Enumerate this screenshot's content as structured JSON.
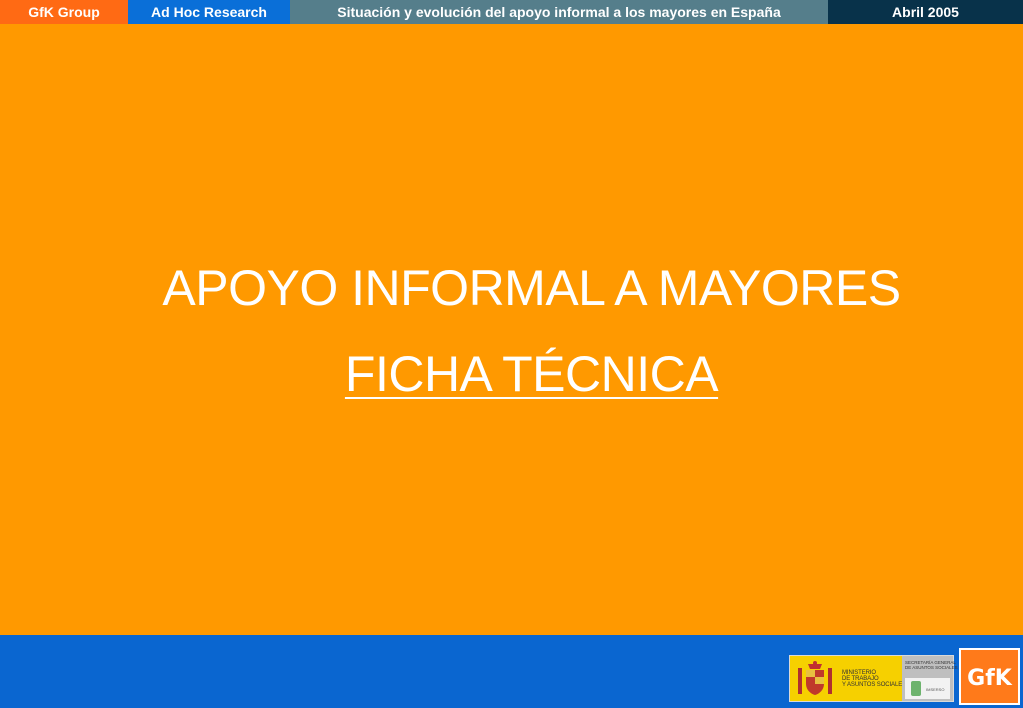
{
  "header": {
    "group": "GfK Group",
    "division": "Ad Hoc Research",
    "study_title": "Situación y evolución del apoyo informal a los mayores en España",
    "date": "Abril 2005"
  },
  "slide": {
    "title_line1": "APOYO INFORMAL A MAYORES",
    "title_line2": "FICHA TÉCNICA"
  },
  "footer": {
    "ministry_lines": [
      "MINISTERIO",
      "DE TRABAJO",
      "Y ASUNTOS SOCIALES"
    ],
    "secretaria_lines": [
      "SECRETARÍA GENERAL",
      "DE ASUNTOS SOCIALES"
    ],
    "imserso": "IMSERSO",
    "gfk_logo": "GfK"
  },
  "colors": {
    "background": "#ff9900",
    "header_group": "#ff6a14",
    "header_division": "#0a6fd8",
    "header_title": "#557e8b",
    "header_date": "#08324a",
    "footer": "#0a66d0"
  }
}
